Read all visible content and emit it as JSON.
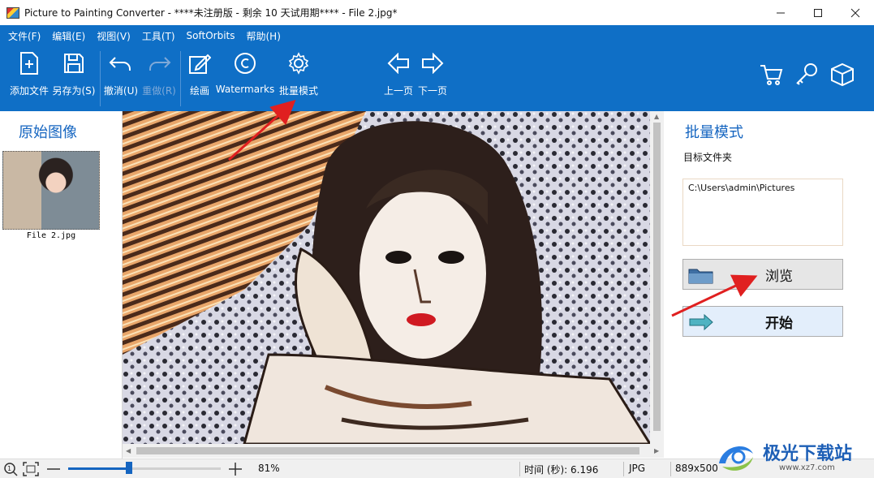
{
  "titlebar": {
    "title": "Picture to Painting Converter - ****未注册版 - 剩余 10 天试用期**** - File 2.jpg*"
  },
  "menu": [
    "文件(F)",
    "编辑(E)",
    "视图(V)",
    "工具(T)",
    "SoftOrbits",
    "帮助(H)"
  ],
  "toolbar": {
    "add_file": "添加文件",
    "save_as": "另存为(S)",
    "undo": "撤消(U)",
    "redo": "重做(R)",
    "paint": "绘画",
    "watermarks": "Watermarks",
    "batch_mode": "批量模式",
    "prev_page": "上一页",
    "next_page": "下一页"
  },
  "left_panel": {
    "title": "原始图像",
    "thumb_caption": "File 2.jpg"
  },
  "right_panel": {
    "title": "批量模式",
    "subtitle": "目标文件夹",
    "folder_path": "C:\\Users\\admin\\Pictures",
    "browse_label": "浏览",
    "start_label": "开始"
  },
  "statusbar": {
    "zoom_level": 0.4,
    "zoom": "81%",
    "time": "时间 (秒): 6.196",
    "format": "JPG",
    "dimensions": "889x500"
  },
  "watermark": {
    "text": "极光下载站",
    "url": "www.xz7.com"
  },
  "colors": {
    "ribbon": "#0f6fc6",
    "accent": "#1565c0",
    "annotation_arrow": "#e02020"
  }
}
